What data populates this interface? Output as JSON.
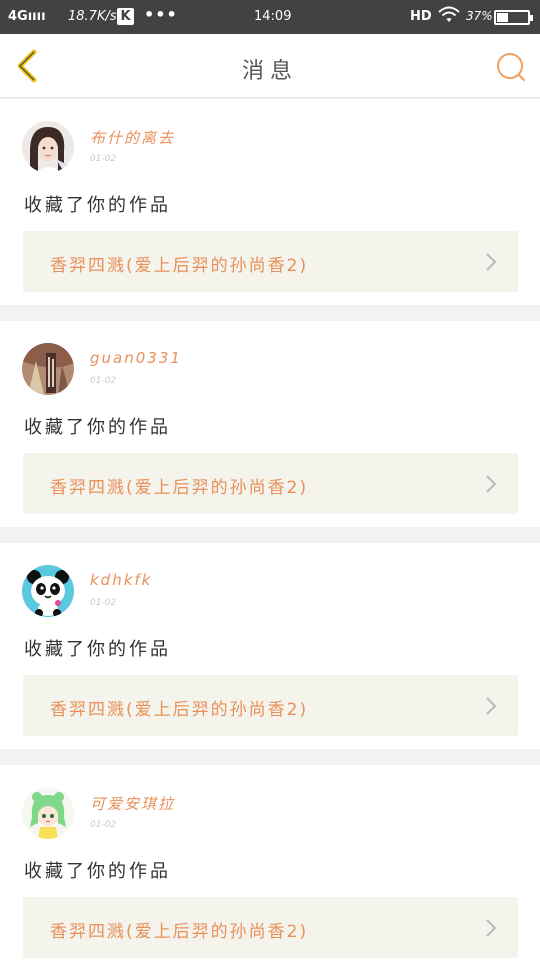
{
  "status_bar": {
    "network": "4Gıııı",
    "speed": "18.7K/s",
    "k_badge": "K",
    "dots": "•••",
    "time": "14:09",
    "hd": "HD",
    "wifi_icon": "wifi-icon",
    "battery_percent": "37%",
    "battery_level": 0.37
  },
  "nav": {
    "title": "消息",
    "back_icon": "back-chevron-icon",
    "search_icon": "search-icon",
    "accent_color": "#e8c21a",
    "search_color": "#f0a060"
  },
  "messages": [
    {
      "username": "布什的离去",
      "date": "01-02",
      "action": "收藏了你的作品",
      "work_title": "香羿四溅(爱上后羿的孙尚香2)"
    },
    {
      "username": "guan0331",
      "date": "01-02",
      "action": "收藏了你的作品",
      "work_title": "香羿四溅(爱上后羿的孙尚香2)"
    },
    {
      "username": "kdhkfk",
      "date": "01-02",
      "action": "收藏了你的作品",
      "work_title": "香羿四溅(爱上后羿的孙尚香2)"
    },
    {
      "username": "可爱安琪拉",
      "date": "01-02",
      "action": "收藏了你的作品",
      "work_title": "香羿四溅(爱上后羿的孙尚香2)"
    }
  ]
}
